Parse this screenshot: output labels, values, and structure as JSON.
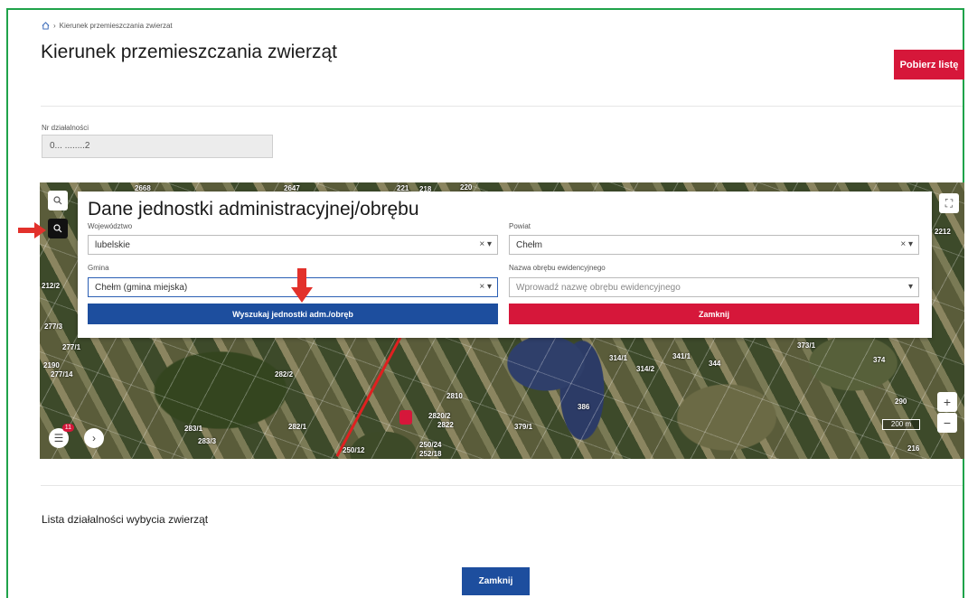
{
  "breadcrumb": {
    "label": "Kierunek przemieszczania zwierzat"
  },
  "page": {
    "title": "Kierunek przemieszczania zwierząt",
    "download_label": "Pobierz listę"
  },
  "activity": {
    "label": "Nr działalności",
    "value": "0... ........2"
  },
  "map": {
    "labels": [
      "2668",
      "2647",
      "221",
      "218",
      "220",
      "2212",
      "212/2",
      "277/3",
      "277/1",
      "2190",
      "277/14",
      "282/2",
      "283/1",
      "282/1",
      "283/3",
      "314/1",
      "314/2",
      "341/1",
      "344",
      "373/1",
      "374",
      "290",
      "2810",
      "2820/2",
      "2822",
      "379/1",
      "386",
      "250/12",
      "250/24",
      "252/18",
      "216"
    ],
    "scale": "200 m",
    "zoom_in": "+",
    "zoom_out": "−",
    "badge": "11"
  },
  "dialog": {
    "title": "Dane jednostki administracyjnej/obrębu",
    "voivodeship_label": "Województwo",
    "voivodeship_value": "lubelskie",
    "district_label": "Powiat",
    "district_value": "Chełm",
    "commune_label": "Gmina",
    "commune_value": "Chełm (gmina miejska)",
    "precinct_label": "Nazwa obrębu ewidencyjnego",
    "precinct_placeholder": "Wprowadź nazwę obrębu ewidencyjnego",
    "search_label": "Wyszukaj jednostki adm./obręb",
    "close_label": "Zamknij",
    "clear_glyph": "× ▾",
    "caret_glyph": "▾"
  },
  "section": {
    "title": "Lista działalności wybycia zwierząt"
  },
  "footer": {
    "close_label": "Zamknij"
  },
  "colors": {
    "red": "#d6173a",
    "blue": "#1d4e9e",
    "frame": "#1fa34a"
  }
}
